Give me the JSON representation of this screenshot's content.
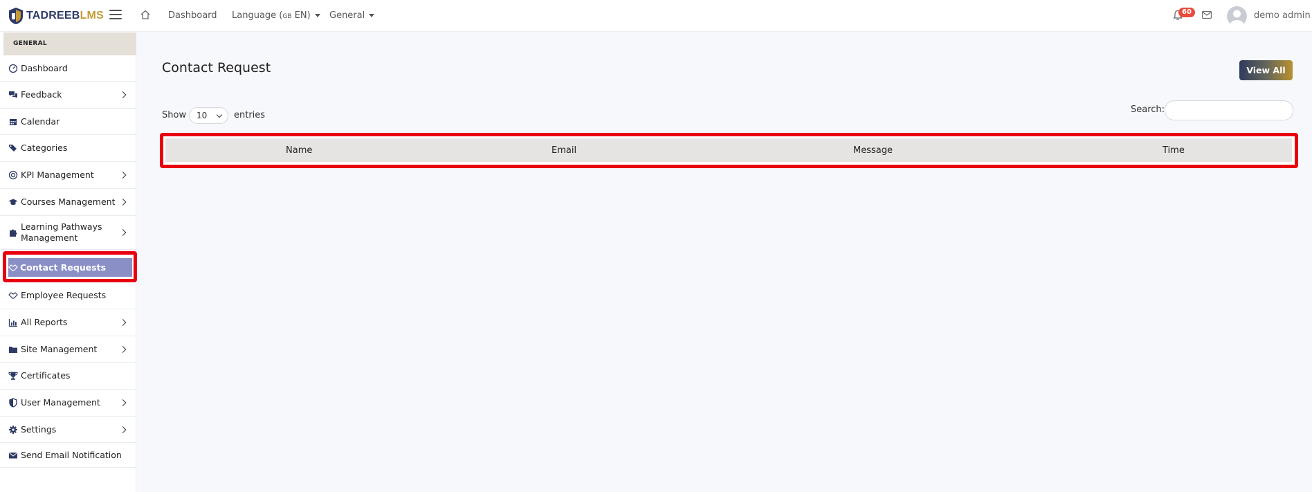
{
  "topbar": {
    "brand_part1": "TADREEB",
    "brand_part2": "LMS",
    "nav_dashboard": "Dashboard",
    "nav_language": "Language (",
    "nav_language_flag": "GB",
    "nav_language_code": " EN)",
    "nav_general": "General",
    "notification_count": "60",
    "user_name": "demo admin"
  },
  "sidebar": {
    "header": "GENERAL",
    "items": [
      {
        "label": "Dashboard",
        "icon": "gauge-icon"
      },
      {
        "label": "Feedback",
        "icon": "comments-icon"
      },
      {
        "label": "Calendar",
        "icon": "calendar-icon"
      },
      {
        "label": "Categories",
        "icon": "tags-icon"
      },
      {
        "label": "KPI Management",
        "icon": "target-icon"
      },
      {
        "label": "Courses Management",
        "icon": "graduation-cap-icon"
      },
      {
        "label": "Learning Pathways Management",
        "icon": "puzzle-icon"
      },
      {
        "label": "Contact Requests",
        "icon": "handshake-icon"
      },
      {
        "label": "Employee Requests",
        "icon": "handshake-icon"
      },
      {
        "label": "All Reports",
        "icon": "bar-chart-icon"
      },
      {
        "label": "Site Management",
        "icon": "folder-icon"
      },
      {
        "label": "Certificates",
        "icon": "trophy-icon"
      },
      {
        "label": "User Management",
        "icon": "shield-icon"
      },
      {
        "label": "Settings",
        "icon": "gear-icon"
      },
      {
        "label": "Send Email Notification",
        "icon": "envelope-icon"
      }
    ]
  },
  "main": {
    "title": "Contact Request",
    "view_all_label": "View All",
    "show_label": "Show",
    "entries_value": "10",
    "entries_label": "entries",
    "search_label": "Search:",
    "search_value": "",
    "columns": [
      "Name",
      "Email",
      "Message",
      "Time"
    ]
  },
  "colors": {
    "highlight_red": "#e8000f",
    "active_item_bg": "#8a8fc6",
    "brand_navy": "#2e3a66",
    "brand_gold": "#c59a34"
  }
}
